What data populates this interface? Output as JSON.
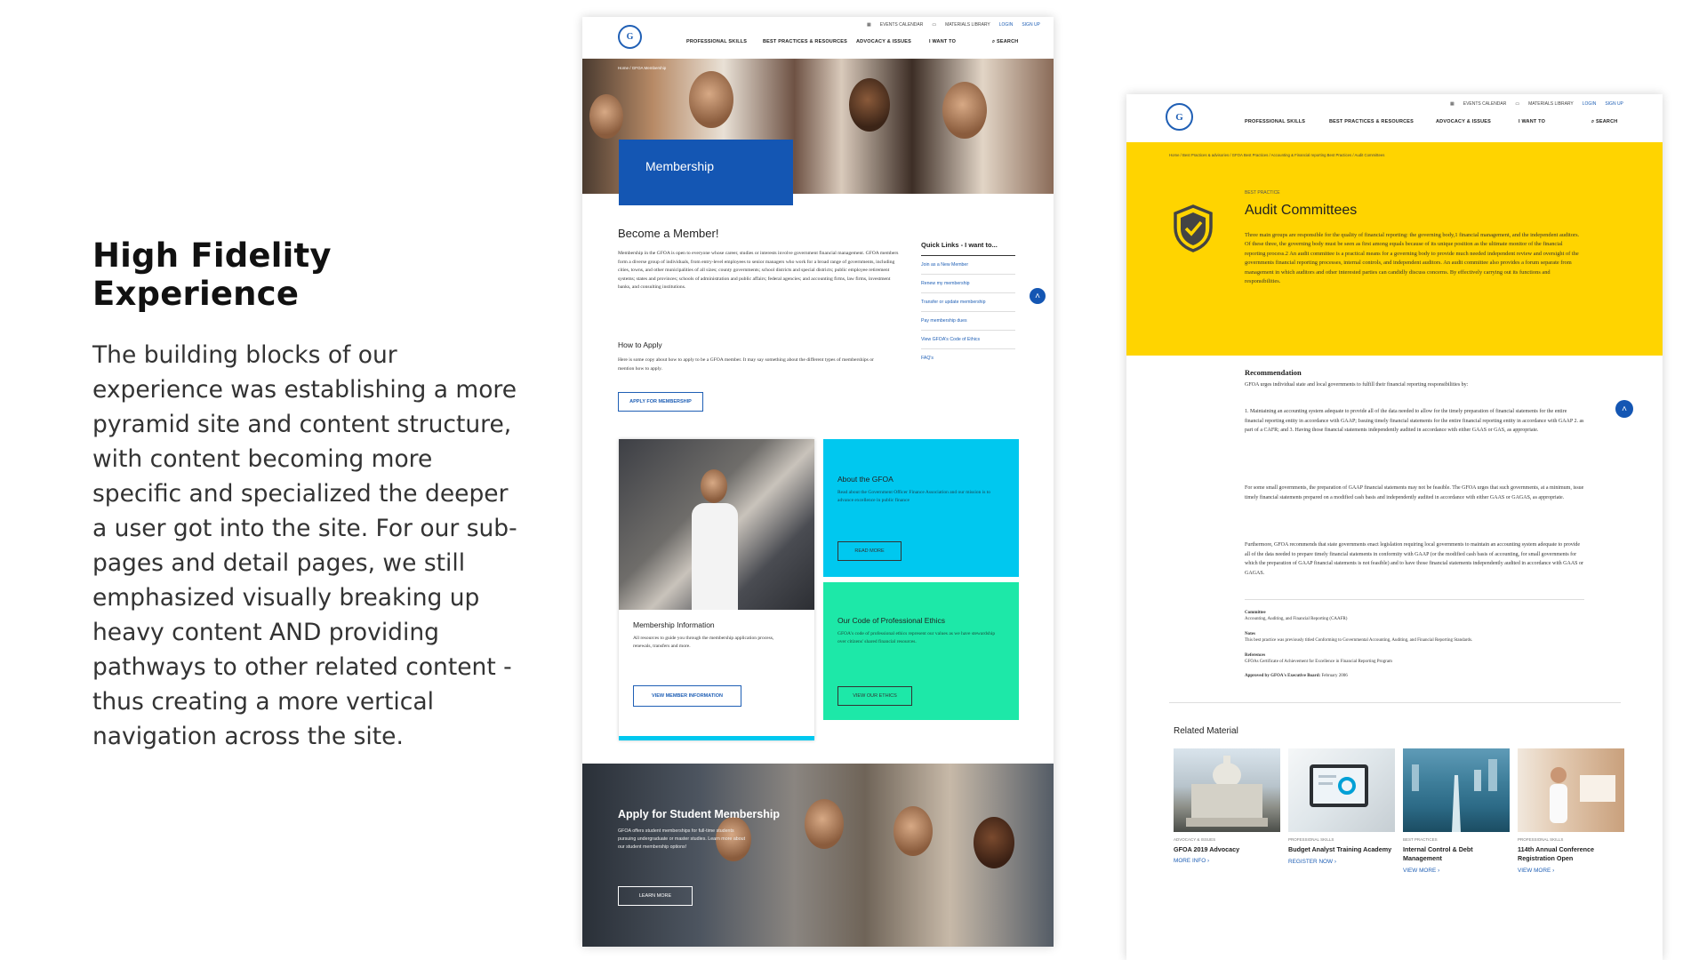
{
  "intro": {
    "title": "High Fidelity Experience",
    "body": "The building blocks of our experience was establishing a more pyramid site and content structure, with content becoming more specific and specialized the deeper a user got into the site. For our sub-pages and detail pages, we still emphasized visually breaking up heavy content AND providing pathways to other related content - thus creating a more vertical navigation across the site."
  },
  "nav": {
    "utility": [
      "EVENTS CALENDAR",
      "MATERIALS LIBRARY",
      "LOGIN",
      "SIGN UP"
    ],
    "main": [
      "PROFESSIONAL SKILLS",
      "BEST PRACTICES & RESOURCES",
      "ADVOCACY & ISSUES",
      "I WANT TO",
      "SEARCH"
    ]
  },
  "icons": {
    "logo": "gfoa-logo",
    "search": "search-icon",
    "scroll_top": "chevron-up-icon",
    "badge": "shield-check-icon"
  },
  "colors": {
    "brand_blue": "#1456b3",
    "cyan": "#00c8ef",
    "mint": "#1de8a8",
    "yellow": "#ffd400"
  },
  "membership": {
    "breadcrumb": "Home / GFOA Membership",
    "hero_label": "Membership",
    "heading": "Become a Member!",
    "intro": "Membership in the GFOA is open to everyone whose career, studies or interests involve government financial management. GFOA members form a diverse group of individuals, from entry-level employees to senior managers who work for a broad range of governments, including cities, towns, and other municipalities of all sizes; county governments; school districts and special districts; public employee retirement systems; states and provinces; schools of administration and public affairs; federal agencies; and accounting firms, law firms, investment banks, and consulting institutions.",
    "how_heading": "How to Apply",
    "how_body": "Here is some copy about how to apply to be a GFOA member. It may say something about the different types of memberships or mention how to apply.",
    "apply_button": "APPLY FOR MEMBERSHIP",
    "quick_links_title": "Quick Links - I want to...",
    "quick_links": [
      "Join as a New Member",
      "Renew my membership",
      "Transfer or update membership",
      "Pay membership dues",
      "View GFOA's Code of Ethics",
      "FAQ's"
    ],
    "card_info": {
      "title": "Membership Information",
      "body": "All resources to guide you through the membership application process, renewals, transfers and more.",
      "button": "VIEW MEMBER INFORMATION"
    },
    "card_about": {
      "title": "About the GFOA",
      "body": "Read about the Government Officer Finance Association and our mission is to advance excellence in public finance",
      "button": "READ MORE"
    },
    "card_ethics": {
      "title": "Our Code of Professional Ethics",
      "body": "GFOA's code of professional ethics represent our values as we have stewardship over citizens' shared financial resources.",
      "button": "VIEW OUR ETHICS"
    },
    "student": {
      "title": "Apply for Student Membership",
      "body": "GFOA offers student memberships for full-time students pursuing undergraduate or master studies. Learn more about our student membership options!",
      "button": "LEARN MORE"
    }
  },
  "audit": {
    "breadcrumb": "Home / Best Practices & advisories / GFOA Best Practices / Accounting & Financial reporting Best Practices / Audit Committees",
    "eyebrow": "BEST PRACTICE",
    "title": "Audit Committees",
    "intro": "Three main groups are responsible for the quality of financial reporting: the governing body,1 financial management, and the independent auditors. Of these three, the governing body must be seen as first among equals because of its unique position as the ultimate monitor of the financial reporting process.2 An audit committee is a practical means for a governing body to provide much needed independent review and oversight of the governments financial reporting processes, internal controls, and independent auditors. An audit committee also provides a forum separate from management in which auditors and other interested parties can candidly discuss concerns. By effectively carrying out its functions and responsibilities.",
    "rec_heading": "Recommendation",
    "rec_lead": "GFOA urges individual state and local governments to fulfill their financial reporting responsibilities by:",
    "rec_list": "1. Maintaining an accounting system adequate to provide all of the data needed to allow for the timely preparation of financial statements for the entire financial reporting entity in accordance with GAAP; Issuing timely financial statements for the entire financial reporting entity in accordance with GAAP 2. as part of a CAFR; and 3. Having those financial statements independently audited in accordance with either GAAS or GAS, as appropriate.",
    "para2": "For some small governments, the preparation of GAAP financial statements may not be feasible. The GFOA urges that such governments, at a minimum, issue timely financial statements prepared on a modified cash basis and independently audited in accordance with either GAAS or GAGAS, as appropriate.",
    "para3": "Furthermore, GFOA recommends that state governments enact legislation requiring local governments to maintain an accounting system adequate to provide all of the data needed to prepare timely financial statements in conformity with GAAP (or the modified cash basis of accounting, for small governments for which the preparation of GAAP financial statements is not feasible) and to have those financial statements independently audited in accordance with GAAS or GAGAS.",
    "committee_label": "Committee",
    "committee": "Accounting, Auditing, and Financial Reporting (CAAFR)",
    "notes_label": "Notes",
    "notes": "This best practice was previously titled Conforming to Governmental Accounting, Auditing, and Financial Reporting Standards.",
    "refs_label": "References",
    "refs": "GFOAs Certificate of Achievement for Excellence in Financial Reporting Program",
    "approved_label": "Approved by GFOA's Executive Board:",
    "approved": "February 2006",
    "related_heading": "Related Material",
    "related": [
      {
        "tag": "ADVOCACY & ISSUES",
        "title": "GFOA 2019 Advocacy",
        "link": "MORE INFO"
      },
      {
        "tag": "PROFESSIONAL SKILLS",
        "title": "Budget Analyst Training Academy",
        "link": "REGISTER NOW"
      },
      {
        "tag": "BEST PRACTICES",
        "title": "Internal Control & Debt Management",
        "link": "VIEW MORE"
      },
      {
        "tag": "PROFESSIONAL SKILLS",
        "title": "114th Annual Conference Registration Open",
        "link": "VIEW MORE"
      }
    ]
  }
}
